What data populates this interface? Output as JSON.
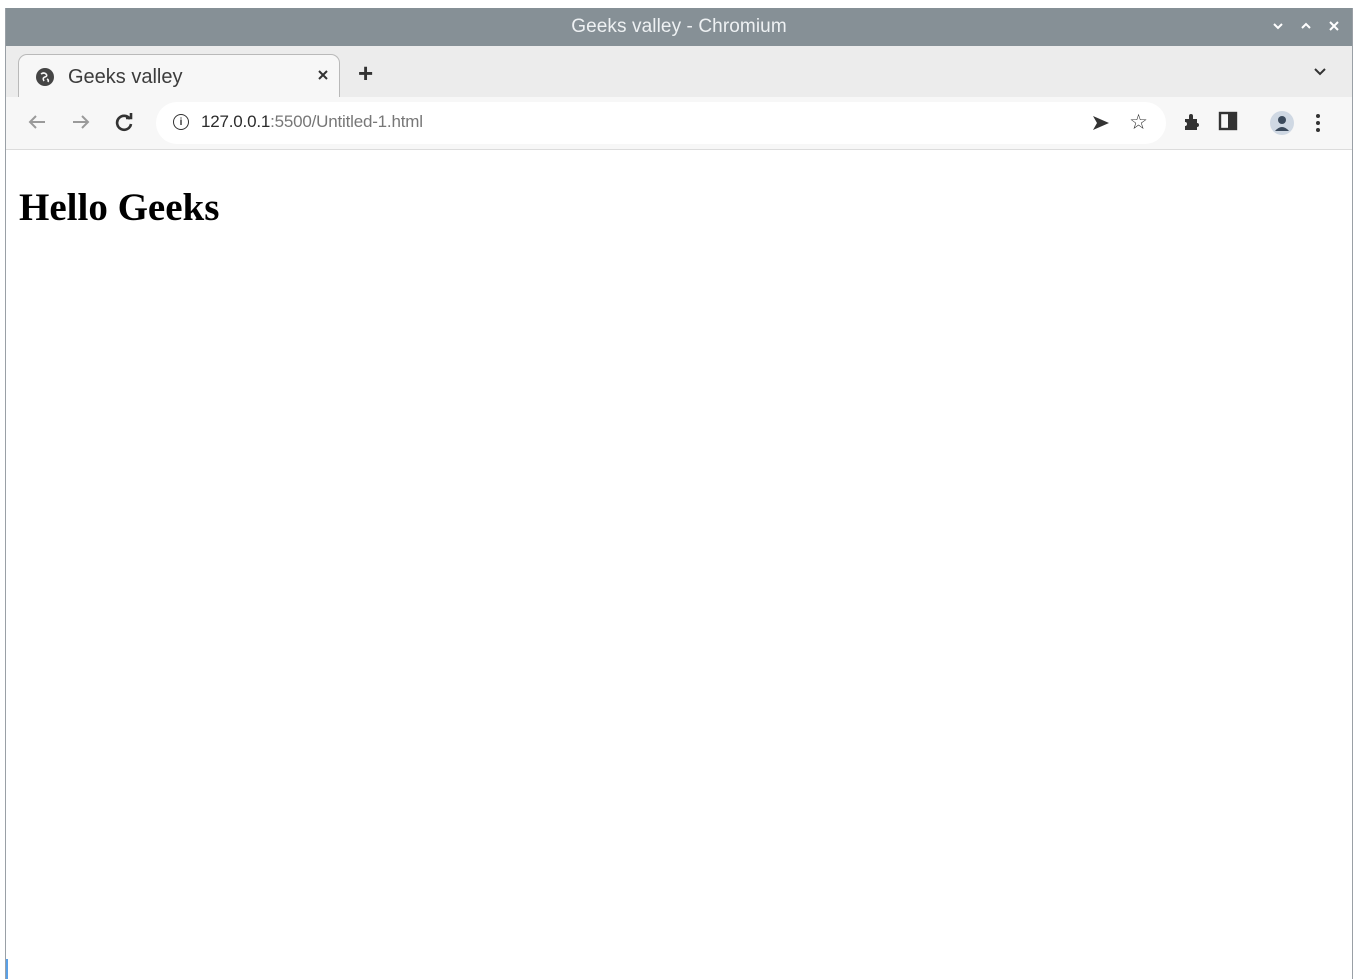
{
  "window": {
    "title": "Geeks valley - Chromium"
  },
  "window_controls": {
    "minimize_icon": "chevron-down",
    "maximize_icon": "chevron-up",
    "close_icon": "x"
  },
  "tabs": [
    {
      "title": "Geeks valley",
      "favicon": "globe-icon",
      "active": true
    }
  ],
  "new_tab_label": "+",
  "address_bar": {
    "host": "127.0.0.1",
    "rest": ":5500/Untitled-1.html"
  },
  "page": {
    "heading": "Hello Geeks"
  },
  "colors": {
    "titlebar": "#869096",
    "tabstrip": "#ececec",
    "toolbar": "#f7f7f7"
  }
}
